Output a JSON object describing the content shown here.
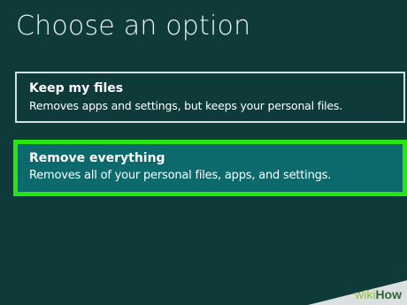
{
  "page": {
    "title": "Choose an option"
  },
  "options": [
    {
      "title": "Keep my files",
      "description": "Removes apps and settings, but keeps your personal files."
    },
    {
      "title": "Remove everything",
      "description": "Removes all of your personal files, apps, and settings."
    }
  ],
  "watermark": {
    "part1": "wiki",
    "part2": "How"
  },
  "colors": {
    "background": "#0e3a3a",
    "selected_option": "#0c6a6c",
    "highlight_border": "#27e614"
  }
}
